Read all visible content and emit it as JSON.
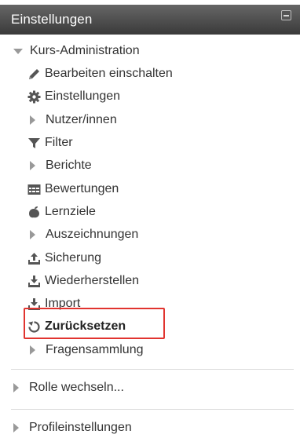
{
  "block": {
    "title": "Einstellungen",
    "collapse_icon": "minus-square-icon"
  },
  "course_admin": {
    "label": "Kurs-Administration",
    "expanded": true,
    "items": [
      {
        "label": "Bearbeiten einschalten",
        "icon": "pencil-icon"
      },
      {
        "label": "Einstellungen",
        "icon": "gear-icon"
      },
      {
        "label": "Nutzer/innen",
        "icon": "expand-arrow-icon"
      },
      {
        "label": "Filter",
        "icon": "filter-icon"
      },
      {
        "label": "Berichte",
        "icon": "expand-arrow-icon"
      },
      {
        "label": "Bewertungen",
        "icon": "gradebook-icon"
      },
      {
        "label": "Lernziele",
        "icon": "outcomes-icon"
      },
      {
        "label": "Auszeichnungen",
        "icon": "expand-arrow-icon"
      },
      {
        "label": "Sicherung",
        "icon": "upload-icon"
      },
      {
        "label": "Wiederherstellen",
        "icon": "download-icon"
      },
      {
        "label": "Import",
        "icon": "download-icon"
      },
      {
        "label": "Zurücksetzen",
        "icon": "reset-icon",
        "highlighted": true
      },
      {
        "label": "Fragensammlung",
        "icon": "expand-arrow-icon"
      }
    ]
  },
  "role_switch": {
    "label": "Rolle wechseln..."
  },
  "profile_settings": {
    "label": "Profileinstellungen"
  },
  "colors": {
    "header_bg": "#4a4a4a",
    "icon_gray": "#999999",
    "highlight_border": "#e1342f"
  }
}
